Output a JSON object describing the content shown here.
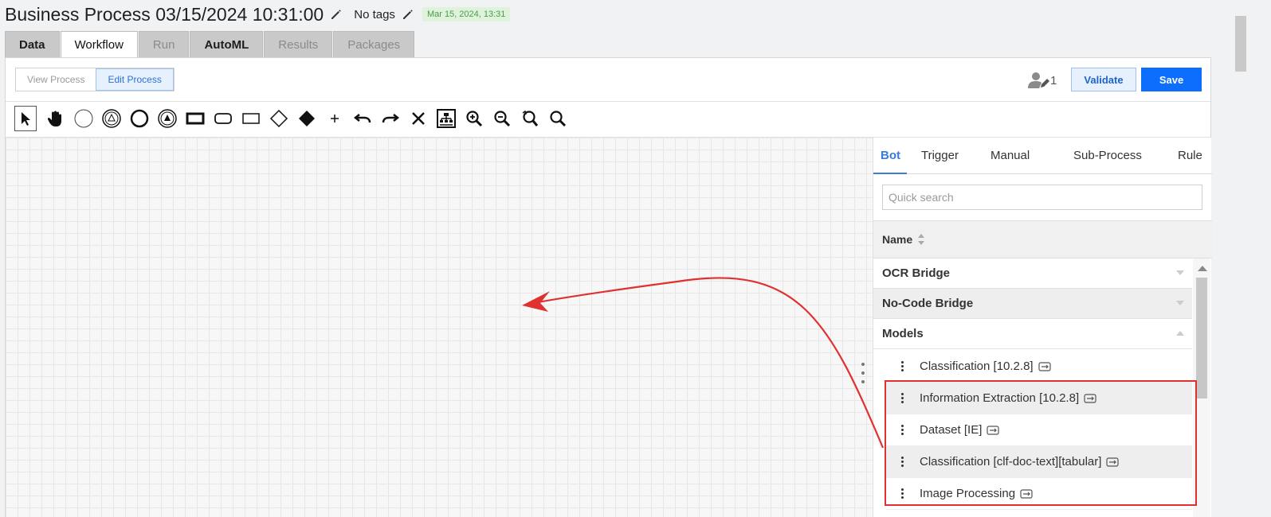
{
  "header": {
    "title": "Business Process 03/15/2024 10:31:00",
    "tags_label": "No tags",
    "date_badge": "Mar 15, 2024, 13:31"
  },
  "tabs": [
    {
      "label": "Data"
    },
    {
      "label": "Workflow"
    },
    {
      "label": "Run"
    },
    {
      "label": "AutoML"
    },
    {
      "label": "Results"
    },
    {
      "label": "Packages"
    }
  ],
  "mode": {
    "view_label": "View Process",
    "edit_label": "Edit Process"
  },
  "actions": {
    "user_count": "1",
    "validate_label": "Validate",
    "save_label": "Save"
  },
  "toolbar": {
    "tools": [
      "select-tool",
      "hand-tool",
      "start-event",
      "start-event-signal",
      "end-event",
      "intermediate-event",
      "task",
      "subprocess",
      "collapsed-subprocess",
      "gateway",
      "exclusive-gateway",
      "add",
      "undo",
      "redo",
      "delete",
      "auto-layout",
      "zoom-in",
      "zoom-out",
      "zoom-reset",
      "zoom-fit"
    ]
  },
  "sidebar": {
    "tabs": [
      {
        "label": "Bot"
      },
      {
        "label": "Trigger"
      },
      {
        "label": "Manual"
      },
      {
        "label": "Sub-Process"
      },
      {
        "label": "Rule"
      }
    ],
    "search_placeholder": "Quick search",
    "name_header": "Name",
    "groups": [
      {
        "label": "OCR Bridge"
      },
      {
        "label": "No-Code Bridge"
      },
      {
        "label": "Models"
      }
    ],
    "items": [
      {
        "label": "Classification [10.2.8]"
      },
      {
        "label": "Information Extraction [10.2.8]"
      },
      {
        "label": "Dataset [IE]"
      },
      {
        "label": "Classification [clf-doc-text][tabular]"
      },
      {
        "label": "Image Processing"
      }
    ]
  },
  "colors": {
    "accent": "#3a7bd5",
    "save": "#0d6efd",
    "annotation": "#e03030",
    "badge_bg": "#dff3dc"
  }
}
